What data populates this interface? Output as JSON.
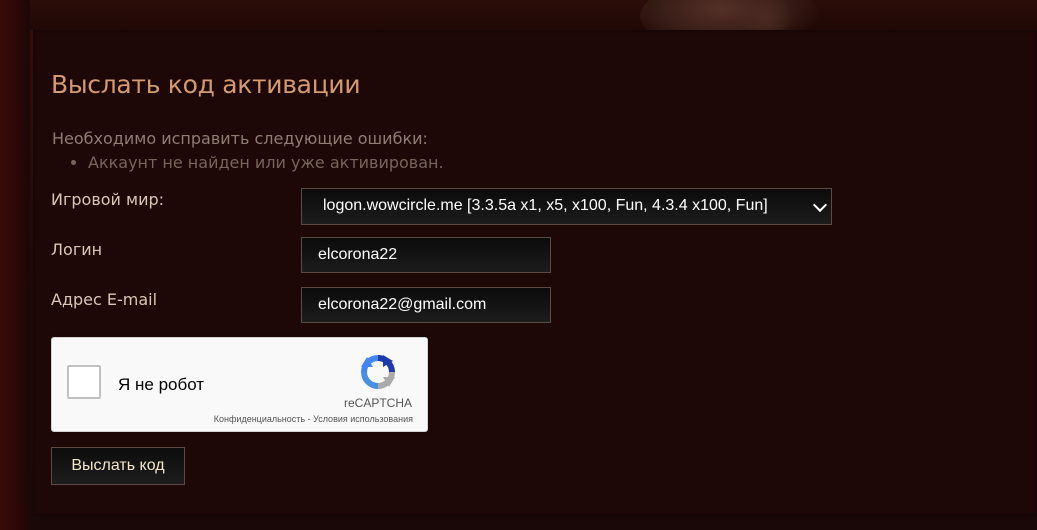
{
  "form": {
    "title": "Выслать код активации",
    "errors": {
      "heading": "Необходимо исправить следующие ошибки:",
      "items": [
        "Аккаунт не найден или уже активирован."
      ]
    },
    "realm": {
      "label": "Игровой мир:",
      "selected": "logon.wowcircle.me [3.3.5a x1, x5, x100, Fun, 4.3.4 x100, Fun]"
    },
    "login": {
      "label": "Логин",
      "value": "elcorona22"
    },
    "email": {
      "label": "Адрес E-mail",
      "value": "elcorona22@gmail.com"
    },
    "captcha": {
      "label": "Я не робот",
      "brand": "reCAPTCHA",
      "privacy": "Конфиденциальность",
      "separator": " - ",
      "terms": "Условия использования"
    },
    "submit_label": "Выслать код"
  },
  "colors": {
    "page_background": "#170707",
    "panel_background": "#1d0807",
    "title": "#d49a72",
    "label": "#d8c7b6",
    "error_text": "#8e7d73",
    "field_background": "#111111",
    "field_border": "#5b4b42",
    "button_text": "#f2e7c9"
  },
  "icons": {
    "select_arrow": "chevron-down-icon",
    "captcha_logo": "recaptcha-logo-icon",
    "checkbox": "checkbox-icon"
  }
}
